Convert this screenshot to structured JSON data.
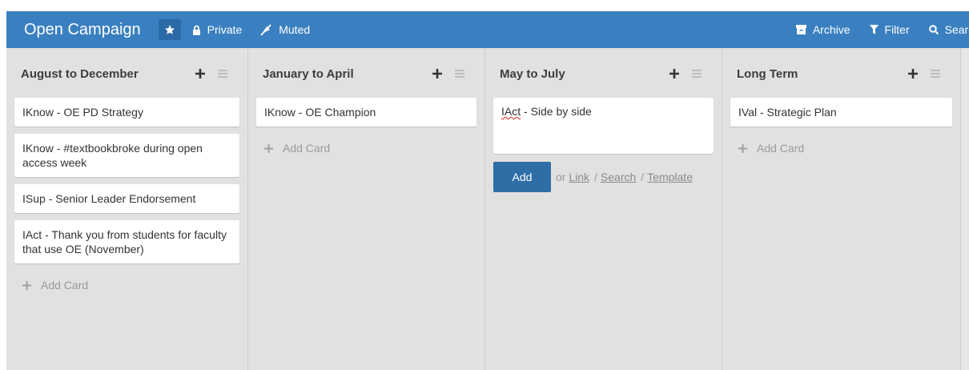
{
  "header": {
    "title": "Open Campaign",
    "private_label": "Private",
    "muted_label": "Muted",
    "archive_label": "Archive",
    "filter_label": "Filter",
    "search_label": "Search",
    "bar_color": "#3a80c0"
  },
  "lists": [
    {
      "title": "August to December",
      "cards": [
        "IKnow - OE PD Strategy",
        "IKnow - #textbookbroke during open access week",
        "ISup - Senior Leader Endorsement",
        "IAct - Thank you from students for faculty that use OE (November)"
      ],
      "add_card": "Add Card"
    },
    {
      "title": "January to April",
      "cards": [
        "IKnow - OE Champion"
      ],
      "add_card": "Add Card"
    },
    {
      "title": "May to July",
      "editor": {
        "text_spell": "IAct",
        "text_rest": " - Side by side",
        "add_button": "Add",
        "or_text": "or",
        "link": "Link",
        "search": "Search",
        "template": "Template"
      }
    },
    {
      "title": "Long Term",
      "cards": [
        "IVal - Strategic Plan"
      ],
      "add_card": "Add Card"
    }
  ]
}
